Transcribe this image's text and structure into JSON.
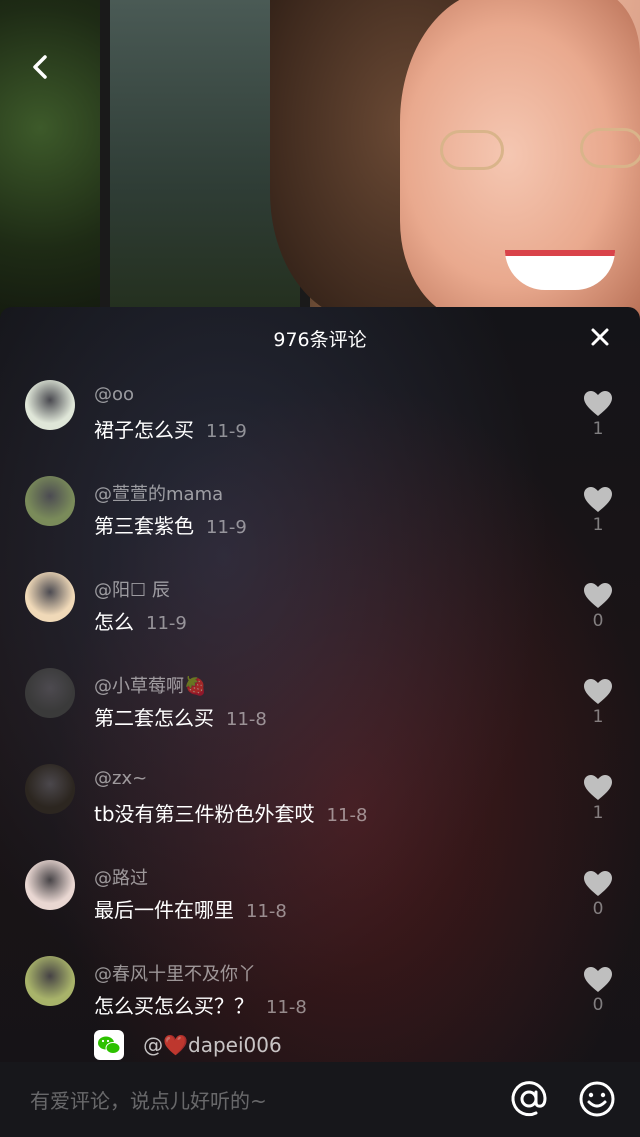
{
  "panel": {
    "title": "976条评论"
  },
  "comments": [
    {
      "user": "@oo",
      "text": "裙子怎么买",
      "date": "11-9",
      "likes": "1",
      "avatar_color": "#dfe6d8"
    },
    {
      "user": "@萱萱的mama",
      "text": "第三套紫色",
      "date": "11-9",
      "likes": "1",
      "avatar_color": "#7a8b5a"
    },
    {
      "user": "@阳☐ 辰",
      "text": "怎么",
      "date": "11-9",
      "likes": "0",
      "avatar_color": "#f0d9b8"
    },
    {
      "user": "@小草莓啊🍓",
      "text": "第二套怎么买",
      "date": "11-8",
      "likes": "1",
      "avatar_color": "#3a3a3a"
    },
    {
      "user": "@zx~",
      "text": "tb没有第三件粉色外套哎",
      "date": "11-8",
      "likes": "1",
      "avatar_color": "#2c2620"
    },
    {
      "user": "@路过",
      "text": "最后一件在哪里",
      "date": "11-8",
      "likes": "0",
      "avatar_color": "#e9d7d2"
    },
    {
      "user": "@春风十里不及你丫",
      "text": "怎么买怎么买？？",
      "date": "11-8",
      "likes": "0",
      "avatar_color": "#a8b36a"
    }
  ],
  "reply": {
    "text": "@❤️dapei006",
    "icon": "wechat-icon"
  },
  "input": {
    "placeholder": "有爱评论，说点儿好听的~"
  },
  "icons": {
    "back": "back-arrow-icon",
    "close": "close-icon",
    "like": "heart-icon",
    "at": "at-icon",
    "emoji": "emoji-icon"
  },
  "colors": {
    "panel_bg": "#151317",
    "text_primary": "#ffffff",
    "text_secondary": "#9a9a9a",
    "heart": "#bfbfbf"
  }
}
